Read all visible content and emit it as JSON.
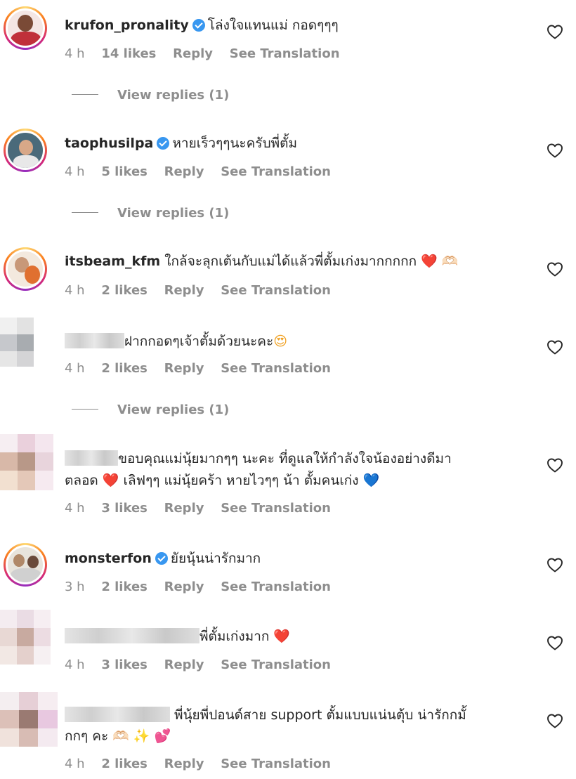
{
  "comments": [
    {
      "username": "krufon_pronality",
      "verified": true,
      "text": "โล่งใจแทนแม่ กอดๆๆๆ",
      "time": "4 h",
      "likes": "14 likes",
      "reply": "Reply",
      "translate": "See Translation",
      "view_replies": "View replies (1)"
    },
    {
      "username": "taophusilpa",
      "verified": true,
      "text": "หายเร็วๆๆนะครับพี่ตั้ม",
      "time": "4 h",
      "likes": "5 likes",
      "reply": "Reply",
      "translate": "See Translation",
      "view_replies": "View replies (1)"
    },
    {
      "username": "itsbeam_kfm",
      "verified": false,
      "text": "ใกล้จะลุกเต้นกับแม่ได้แล้วพี่ตั้มเก่งมากกกกก",
      "emoji": "❤️ 🫶🏻",
      "time": "4 h",
      "likes": "2 likes",
      "reply": "Reply",
      "translate": "See Translation"
    },
    {
      "username": "",
      "verified": false,
      "text": "ฝากกอดๆเจ้าตั้มด้วยนะคะ",
      "emoji": "😍",
      "time": "4 h",
      "likes": "2 likes",
      "reply": "Reply",
      "translate": "See Translation",
      "view_replies": "View replies (1)"
    },
    {
      "username": "",
      "verified": false,
      "text": "ขอบคุณแม่นุ้ยมากๆๆ นะคะ ที่ดูแลให้กำลังใจน้องอย่างดีมา",
      "text2_a": "ตลอด",
      "text2_b": "เลิฟๆๆ แม่นุ้ยคร้า หายไวๆๆ น้า ตั้มคนเก่ง",
      "emoji_a": "❤️",
      "emoji_b": "💙",
      "time": "4 h",
      "likes": "3 likes",
      "reply": "Reply",
      "translate": "See Translation"
    },
    {
      "username": "monsterfon",
      "verified": true,
      "text": "ยัยนุ้นน่ารักมาก",
      "time": "3 h",
      "likes": "2 likes",
      "reply": "Reply",
      "translate": "See Translation"
    },
    {
      "username": "",
      "verified": false,
      "text": "พี่ตั้มเก่งมาก",
      "emoji": "❤️",
      "time": "4 h",
      "likes": "3 likes",
      "reply": "Reply",
      "translate": "See Translation"
    },
    {
      "username": "",
      "verified": false,
      "text": "พี่นุ้ยพี่ปอนด์สาย support ตั้มแบบแน่นตุ้บ น่ารักกมั้",
      "text2": "กกๆ คะ",
      "emoji2": "🫶🏻 ✨ 💕",
      "time": "4 h",
      "likes": "2 likes",
      "reply": "Reply",
      "translate": "See Translation"
    }
  ],
  "icons": {
    "like": "heart-outline-icon",
    "verified": "verified-badge-icon"
  },
  "colors": {
    "verified": "#3897f0",
    "meta_text": "#8e8e8e",
    "username": "#262626"
  }
}
